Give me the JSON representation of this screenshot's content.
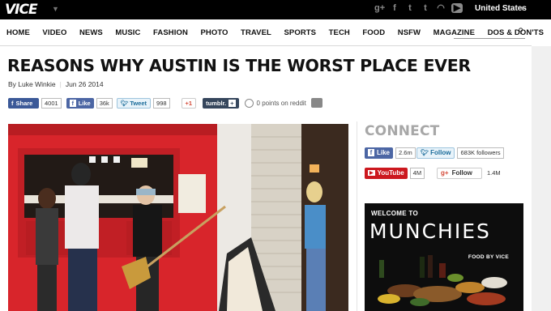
{
  "header": {
    "logo": "VICE",
    "region": "United States",
    "social_icons": [
      "google-plus-icon",
      "facebook-icon",
      "twitter-icon",
      "tumblr-icon",
      "rss-icon",
      "youtube-icon"
    ]
  },
  "nav": {
    "items": [
      "HOME",
      "VIDEO",
      "NEWS",
      "MUSIC",
      "FASHION",
      "PHOTO",
      "TRAVEL",
      "SPORTS",
      "TECH",
      "FOOD",
      "NSFW",
      "MAGAZINE",
      "DOS & DON'TS"
    ],
    "search_placeholder": ""
  },
  "article": {
    "title": "REASONS WHY AUSTIN IS THE WORST PLACE EVER",
    "author": "By Luke Winkie",
    "date": "Jun 26 2014",
    "share": {
      "fb_share_label": "Share",
      "fb_share_count": "4001",
      "fb_like_label": "Like",
      "fb_like_count": "36k",
      "tweet_label": "Tweet",
      "tweet_count": "998",
      "gplus_label": "+1",
      "tumblr_label": "tumblr.",
      "reddit_text": "0 points on reddit"
    }
  },
  "sidebar": {
    "connect_title": "CONNECT",
    "fb_like_label": "Like",
    "fb_like_count": "2.6m",
    "twitter_label": "Follow",
    "twitter_count": "683K followers",
    "youtube_label": "YouTube",
    "youtube_count": "4M",
    "gplus_label": "Follow",
    "gplus_count": "1.4M",
    "ad": {
      "welcome": "WELCOME TO",
      "title": "MUNCHIES",
      "subtitle": "FOOD BY VICE"
    }
  },
  "colors": {
    "facebook": "#3b5998",
    "twitter": "#1b6c9a",
    "youtube": "#cc181e",
    "google_plus": "#d34836",
    "tumblr": "#35465c"
  }
}
